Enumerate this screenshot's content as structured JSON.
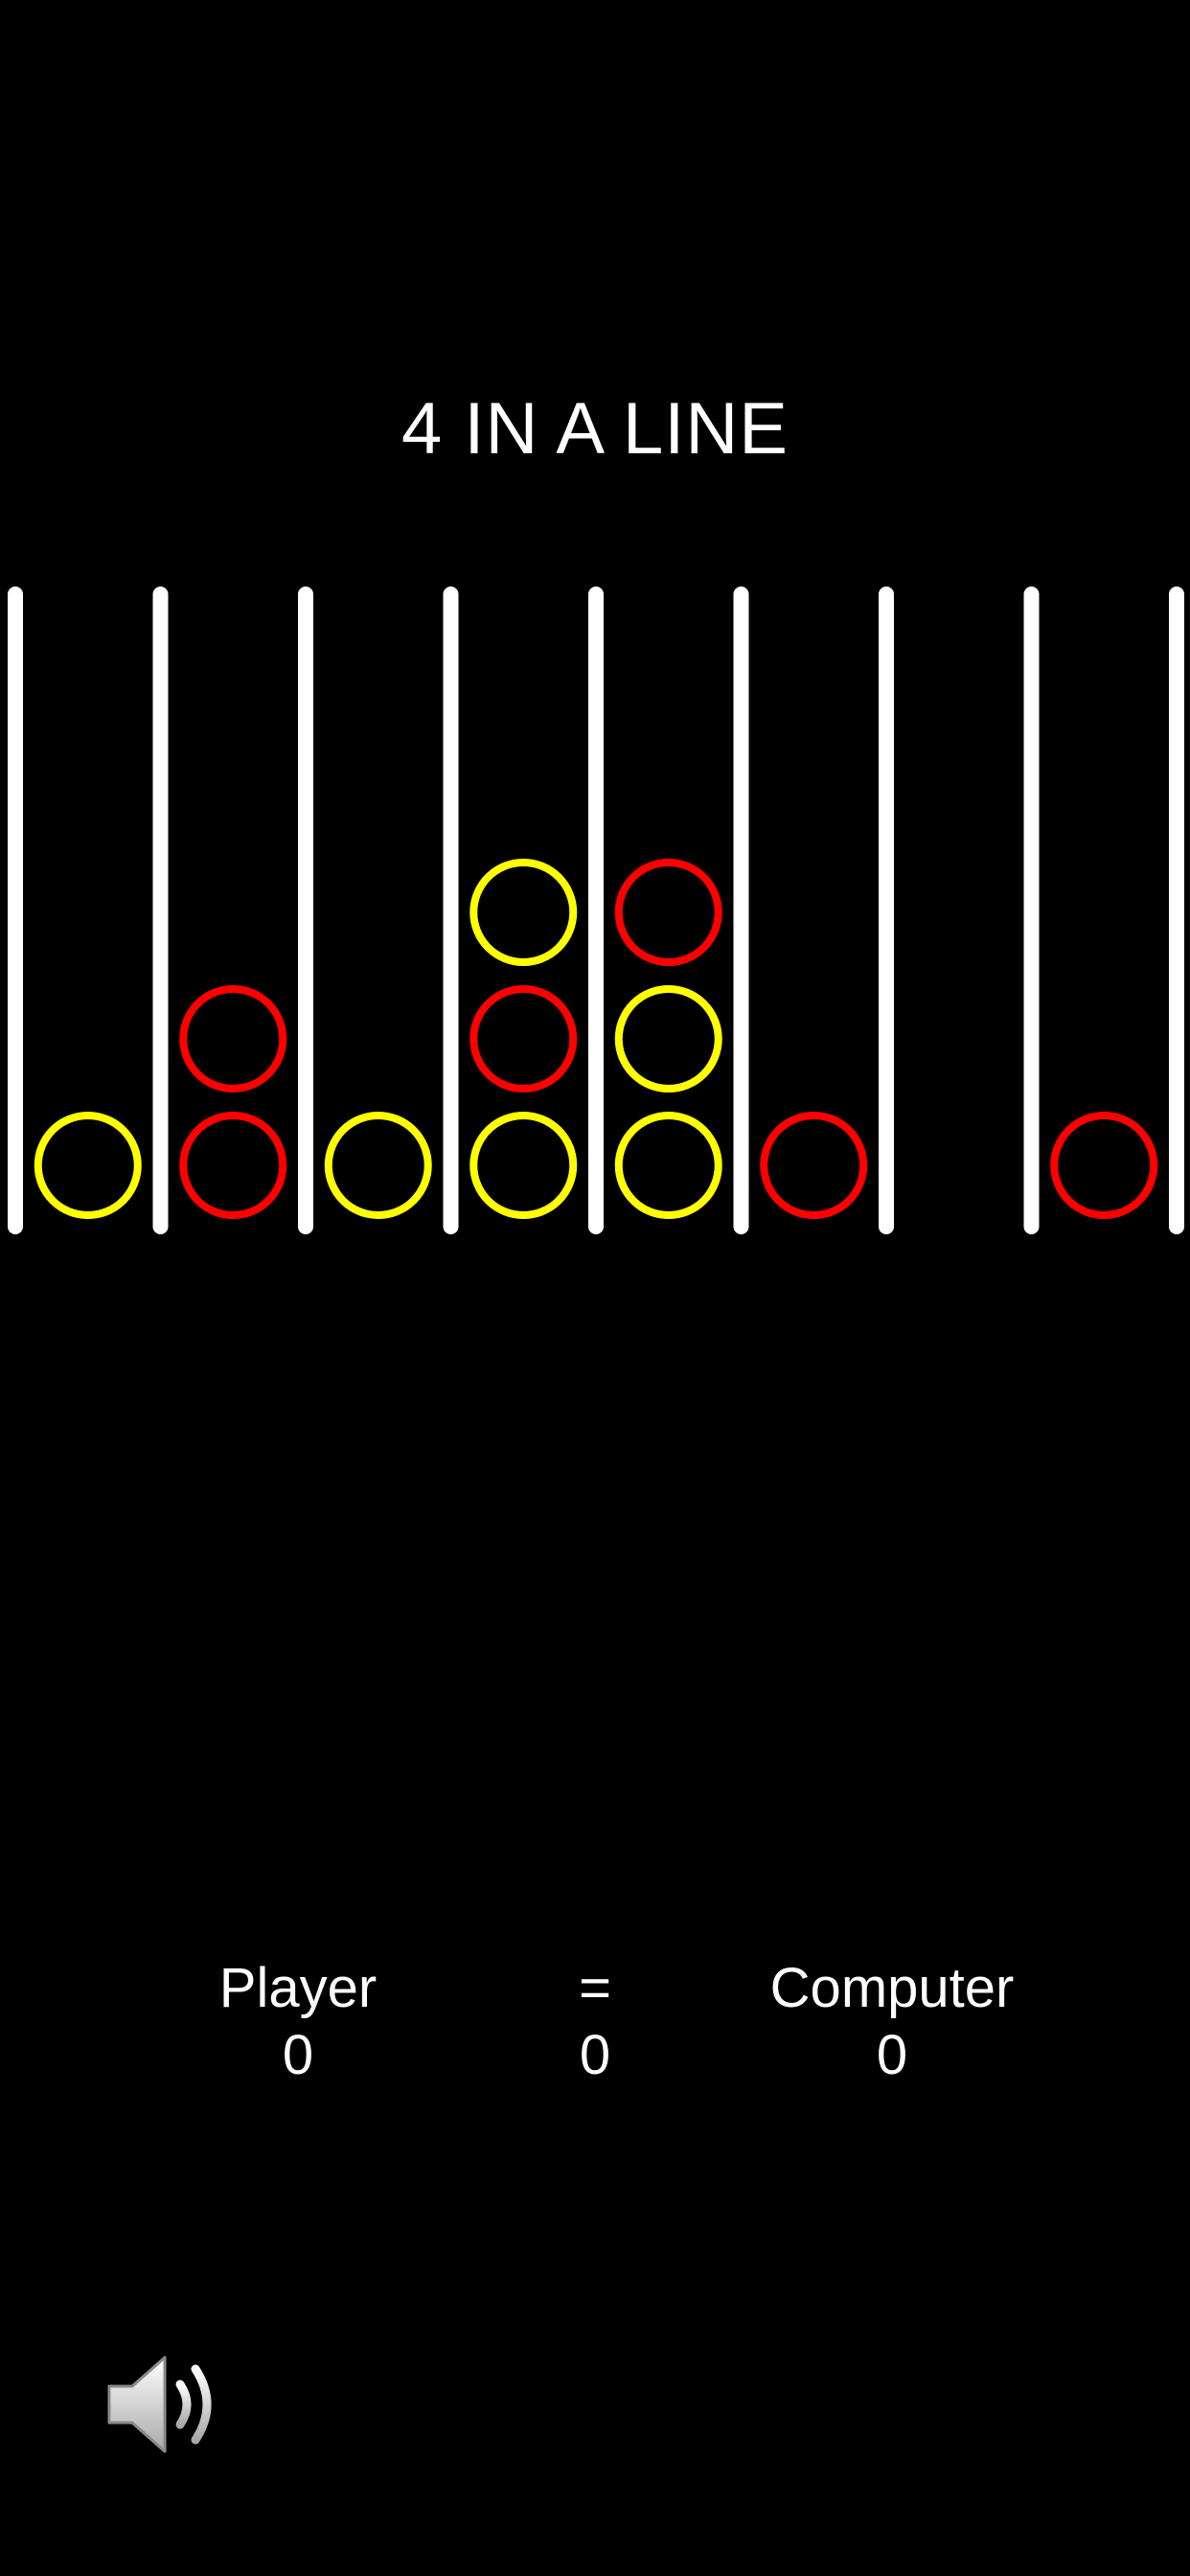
{
  "game": {
    "title": "4 IN A LINE"
  },
  "board": {
    "columns": 8,
    "rows": 6,
    "colors": {
      "rods": "#ffffff",
      "player": "#ffff00",
      "computer": "#ff0000",
      "background": "#000000"
    },
    "discs": [
      {
        "column": 0,
        "row": 0,
        "owner": "player"
      },
      {
        "column": 1,
        "row": 0,
        "owner": "computer"
      },
      {
        "column": 1,
        "row": 1,
        "owner": "computer"
      },
      {
        "column": 2,
        "row": 0,
        "owner": "player"
      },
      {
        "column": 3,
        "row": 0,
        "owner": "player"
      },
      {
        "column": 3,
        "row": 1,
        "owner": "computer"
      },
      {
        "column": 3,
        "row": 2,
        "owner": "player"
      },
      {
        "column": 4,
        "row": 0,
        "owner": "player"
      },
      {
        "column": 4,
        "row": 1,
        "owner": "player"
      },
      {
        "column": 4,
        "row": 2,
        "owner": "computer"
      },
      {
        "column": 5,
        "row": 0,
        "owner": "computer"
      },
      {
        "column": 7,
        "row": 0,
        "owner": "computer"
      }
    ]
  },
  "scoreboard": {
    "player": {
      "label": "Player",
      "value": "0"
    },
    "draw": {
      "label": "=",
      "value": "0"
    },
    "computer": {
      "label": "Computer",
      "value": "0"
    }
  },
  "controls": {
    "sound": {
      "icon": "speaker-icon",
      "state": "on"
    }
  }
}
